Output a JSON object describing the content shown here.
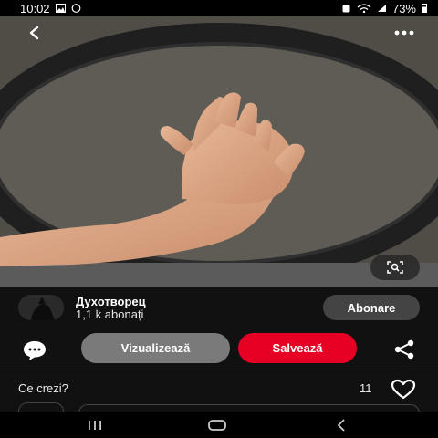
{
  "status_bar": {
    "time": "10:02",
    "battery": "73%"
  },
  "creator": {
    "name": "Духотворец",
    "followers": "1,1 k abonați",
    "follow_label": "Abonare"
  },
  "actions": {
    "view_label": "Vizualizează",
    "save_label": "Salvează"
  },
  "comments": {
    "prompt": "Ce crezi?",
    "likes_count": "11"
  },
  "colors": {
    "save": "#e60023",
    "view": "#7a7a7a",
    "follow": "#444444",
    "background": "#111111"
  },
  "icons": [
    "back-arrow-icon",
    "more-icon",
    "visual-search-icon",
    "comment-icon",
    "share-icon",
    "heart-icon",
    "recents-icon",
    "home-icon",
    "back-nav-icon"
  ]
}
